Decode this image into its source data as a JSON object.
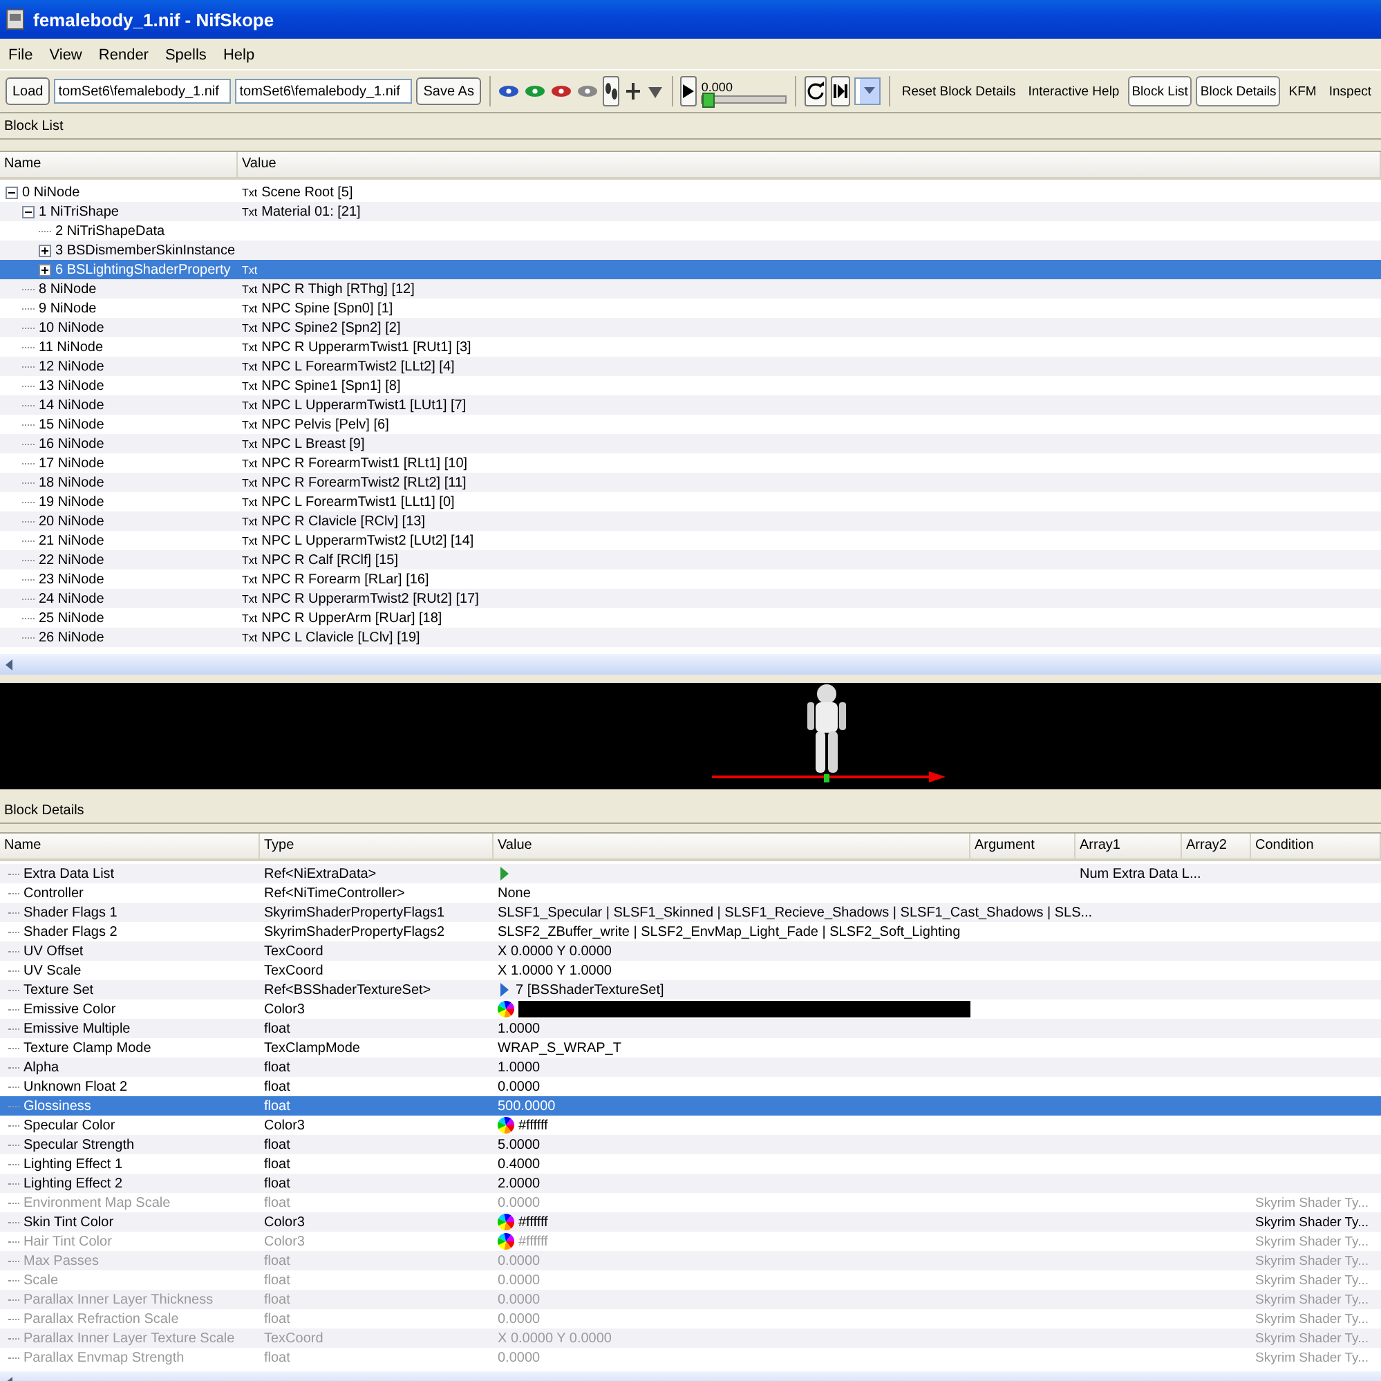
{
  "window": {
    "title": "femalebody_1.nif - NifSkope"
  },
  "menu": [
    "File",
    "View",
    "Render",
    "Spells",
    "Help"
  ],
  "toolbar": {
    "load": "Load",
    "paths": [
      "tomSet6\\femalebody_1.nif",
      "tomSet6\\femalebody_1.nif"
    ],
    "save_as": "Save As",
    "time": "0.000",
    "time_slider": {
      "level": 0
    },
    "tools": [
      {
        "label": "Reset Block Details",
        "kind": "plain"
      },
      {
        "label": "Interactive Help",
        "kind": "plain"
      },
      {
        "label": "Block List",
        "kind": "toggle",
        "on": true
      },
      {
        "label": "Block Details",
        "kind": "toggle",
        "on": true
      },
      {
        "label": "KFM",
        "kind": "plain"
      },
      {
        "label": "Inspect",
        "kind": "plain"
      }
    ]
  },
  "block_list": {
    "title": "Block List",
    "columns": [
      "Name",
      "Value"
    ],
    "rows": [
      {
        "name": "0 NiNode",
        "tag": "Txt",
        "value": "Scene Root [5]",
        "selected": false,
        "expanded": true,
        "children": [
          {
            "name": "1 NiTriShape",
            "tag": "Txt",
            "value": "Material 01: [21]",
            "selected": false,
            "expanded": true,
            "children": [
              {
                "name": "2 NiTriShapeData",
                "selected": false
              },
              {
                "name": "3 BSDismemberSkinInstance",
                "selected": false,
                "expanded": false
              },
              {
                "name": "6 BSLightingShaderProperty",
                "tag": "Txt",
                "selected": true,
                "expanded": false
              }
            ]
          },
          {
            "name": "8 NiNode",
            "tag": "Txt",
            "value": "NPC R Thigh [RThg] [12]",
            "selected": false
          },
          {
            "name": "9 NiNode",
            "tag": "Txt",
            "value": "NPC Spine [Spn0] [1]",
            "selected": false
          },
          {
            "name": "10 NiNode",
            "tag": "Txt",
            "value": "NPC Spine2 [Spn2] [2]",
            "selected": false
          },
          {
            "name": "11 NiNode",
            "tag": "Txt",
            "value": "NPC R UpperarmTwist1 [RUt1] [3]",
            "selected": false
          },
          {
            "name": "12 NiNode",
            "tag": "Txt",
            "value": "NPC L ForearmTwist2 [LLt2] [4]",
            "selected": false
          },
          {
            "name": "13 NiNode",
            "tag": "Txt",
            "value": "NPC Spine1 [Spn1] [8]",
            "selected": false
          },
          {
            "name": "14 NiNode",
            "tag": "Txt",
            "value": "NPC L UpperarmTwist1 [LUt1] [7]",
            "selected": false
          },
          {
            "name": "15 NiNode",
            "tag": "Txt",
            "value": "NPC Pelvis [Pelv] [6]",
            "selected": false
          },
          {
            "name": "16 NiNode",
            "tag": "Txt",
            "value": "NPC L Breast [9]",
            "selected": false
          },
          {
            "name": "17 NiNode",
            "tag": "Txt",
            "value": "NPC R ForearmTwist1 [RLt1] [10]",
            "selected": false
          },
          {
            "name": "18 NiNode",
            "tag": "Txt",
            "value": "NPC R ForearmTwist2 [RLt2] [11]",
            "selected": false
          },
          {
            "name": "19 NiNode",
            "tag": "Txt",
            "value": "NPC L ForearmTwist1 [LLt1] [0]",
            "selected": false
          },
          {
            "name": "20 NiNode",
            "tag": "Txt",
            "value": "NPC R Clavicle [RClv] [13]",
            "selected": false
          },
          {
            "name": "21 NiNode",
            "tag": "Txt",
            "value": "NPC L UpperarmTwist2 [LUt2] [14]",
            "selected": false
          },
          {
            "name": "22 NiNode",
            "tag": "Txt",
            "value": "NPC R Calf [RClf] [15]",
            "selected": false
          },
          {
            "name": "23 NiNode",
            "tag": "Txt",
            "value": "NPC R Forearm [RLar] [16]",
            "selected": false
          },
          {
            "name": "24 NiNode",
            "tag": "Txt",
            "value": "NPC R UpperarmTwist2 [RUt2] [17]",
            "selected": false
          },
          {
            "name": "25 NiNode",
            "tag": "Txt",
            "value": "NPC R UpperArm [RUar] [18]",
            "selected": false
          },
          {
            "name": "26 NiNode",
            "tag": "Txt",
            "value": "NPC L Clavicle [LClv] [19]",
            "selected": false
          }
        ]
      }
    ]
  },
  "block_details": {
    "title": "Block Details",
    "columns": [
      "Name",
      "Type",
      "Value",
      "Argument",
      "Array1",
      "Array2",
      "Condition"
    ],
    "rows": [
      {
        "name": "Extra Data List",
        "type": "Ref<NiExtraData>",
        "kind": "link",
        "array1": "Num Extra Data L...",
        "disabled": false,
        "selected": false
      },
      {
        "name": "Controller",
        "type": "Ref<NiTimeController>",
        "kind": "text",
        "value": "None",
        "disabled": false,
        "selected": false
      },
      {
        "name": "Shader Flags 1",
        "type": "SkyrimShaderPropertyFlags1",
        "kind": "text",
        "value": "SLSF1_Specular | SLSF1_Skinned | SLSF1_Recieve_Shadows | SLSF1_Cast_Shadows | SLS...",
        "disabled": false,
        "selected": false
      },
      {
        "name": "Shader Flags 2",
        "type": "SkyrimShaderPropertyFlags2",
        "kind": "text",
        "value": "SLSF2_ZBuffer_write | SLSF2_EnvMap_Light_Fade | SLSF2_Soft_Lighting",
        "disabled": false,
        "selected": false
      },
      {
        "name": "UV Offset",
        "type": "TexCoord",
        "kind": "text",
        "value": "X 0.0000 Y 0.0000",
        "disabled": false,
        "selected": false
      },
      {
        "name": "UV Scale",
        "type": "TexCoord",
        "kind": "text",
        "value": "X 1.0000 Y 1.0000",
        "disabled": false,
        "selected": false
      },
      {
        "name": "Texture Set",
        "type": "Ref<BSShaderTextureSet>",
        "kind": "link",
        "value": "7 [BSShaderTextureSet]",
        "disabled": false,
        "selected": false
      },
      {
        "name": "Emissive Color",
        "type": "Color3",
        "kind": "swatch",
        "color": "#000000",
        "disabled": false,
        "selected": false
      },
      {
        "name": "Emissive Multiple",
        "type": "float",
        "kind": "text",
        "value": "1.0000",
        "disabled": false,
        "selected": false
      },
      {
        "name": "Texture Clamp Mode",
        "type": "TexClampMode",
        "kind": "text",
        "value": "WRAP_S_WRAP_T",
        "disabled": false,
        "selected": false
      },
      {
        "name": "Alpha",
        "type": "float",
        "kind": "text",
        "value": "1.0000",
        "disabled": false,
        "selected": false
      },
      {
        "name": "Unknown Float 2",
        "type": "float",
        "kind": "text",
        "value": "0.0000",
        "disabled": false,
        "selected": false
      },
      {
        "name": "Glossiness",
        "type": "float",
        "kind": "text",
        "value": "500.0000",
        "disabled": false,
        "selected": true
      },
      {
        "name": "Specular Color",
        "type": "Color3",
        "kind": "color",
        "value": "#ffffff",
        "disabled": false,
        "selected": false
      },
      {
        "name": "Specular Strength",
        "type": "float",
        "kind": "text",
        "value": "5.0000",
        "disabled": false,
        "selected": false
      },
      {
        "name": "Lighting Effect 1",
        "type": "float",
        "kind": "text",
        "value": "0.4000",
        "disabled": false,
        "selected": false
      },
      {
        "name": "Lighting Effect 2",
        "type": "float",
        "kind": "text",
        "value": "2.0000",
        "disabled": false,
        "selected": false
      },
      {
        "name": "Environment Map Scale",
        "type": "float",
        "kind": "text",
        "value": "0.0000",
        "condition": "Skyrim Shader Ty...",
        "disabled": true,
        "selected": false
      },
      {
        "name": "Skin Tint Color",
        "type": "Color3",
        "kind": "color",
        "value": "#ffffff",
        "condition": "Skyrim Shader Ty...",
        "disabled": false,
        "selected": false
      },
      {
        "name": "Hair Tint Color",
        "type": "Color3",
        "kind": "color",
        "value": "#ffffff",
        "condition": "Skyrim Shader Ty...",
        "disabled": true,
        "selected": false
      },
      {
        "name": "Max Passes",
        "type": "float",
        "kind": "text",
        "value": "0.0000",
        "condition": "Skyrim Shader Ty...",
        "disabled": true,
        "selected": false
      },
      {
        "name": "Scale",
        "type": "float",
        "kind": "text",
        "value": "0.0000",
        "condition": "Skyrim Shader Ty...",
        "disabled": true,
        "selected": false
      },
      {
        "name": "Parallax Inner Layer Thickness",
        "type": "float",
        "kind": "text",
        "value": "0.0000",
        "condition": "Skyrim Shader Ty...",
        "disabled": true,
        "selected": false
      },
      {
        "name": "Parallax Refraction Scale",
        "type": "float",
        "kind": "text",
        "value": "0.0000",
        "condition": "Skyrim Shader Ty...",
        "disabled": true,
        "selected": false
      },
      {
        "name": "Parallax Inner Layer Texture Scale",
        "type": "TexCoord",
        "kind": "text",
        "value": "X 0.0000 Y 0.0000",
        "condition": "Skyrim Shader Ty...",
        "disabled": true,
        "selected": false
      },
      {
        "name": "Parallax Envmap Strength",
        "type": "float",
        "kind": "text",
        "value": "0.0000",
        "condition": "Skyrim Shader Ty...",
        "disabled": true,
        "selected": false
      }
    ]
  }
}
